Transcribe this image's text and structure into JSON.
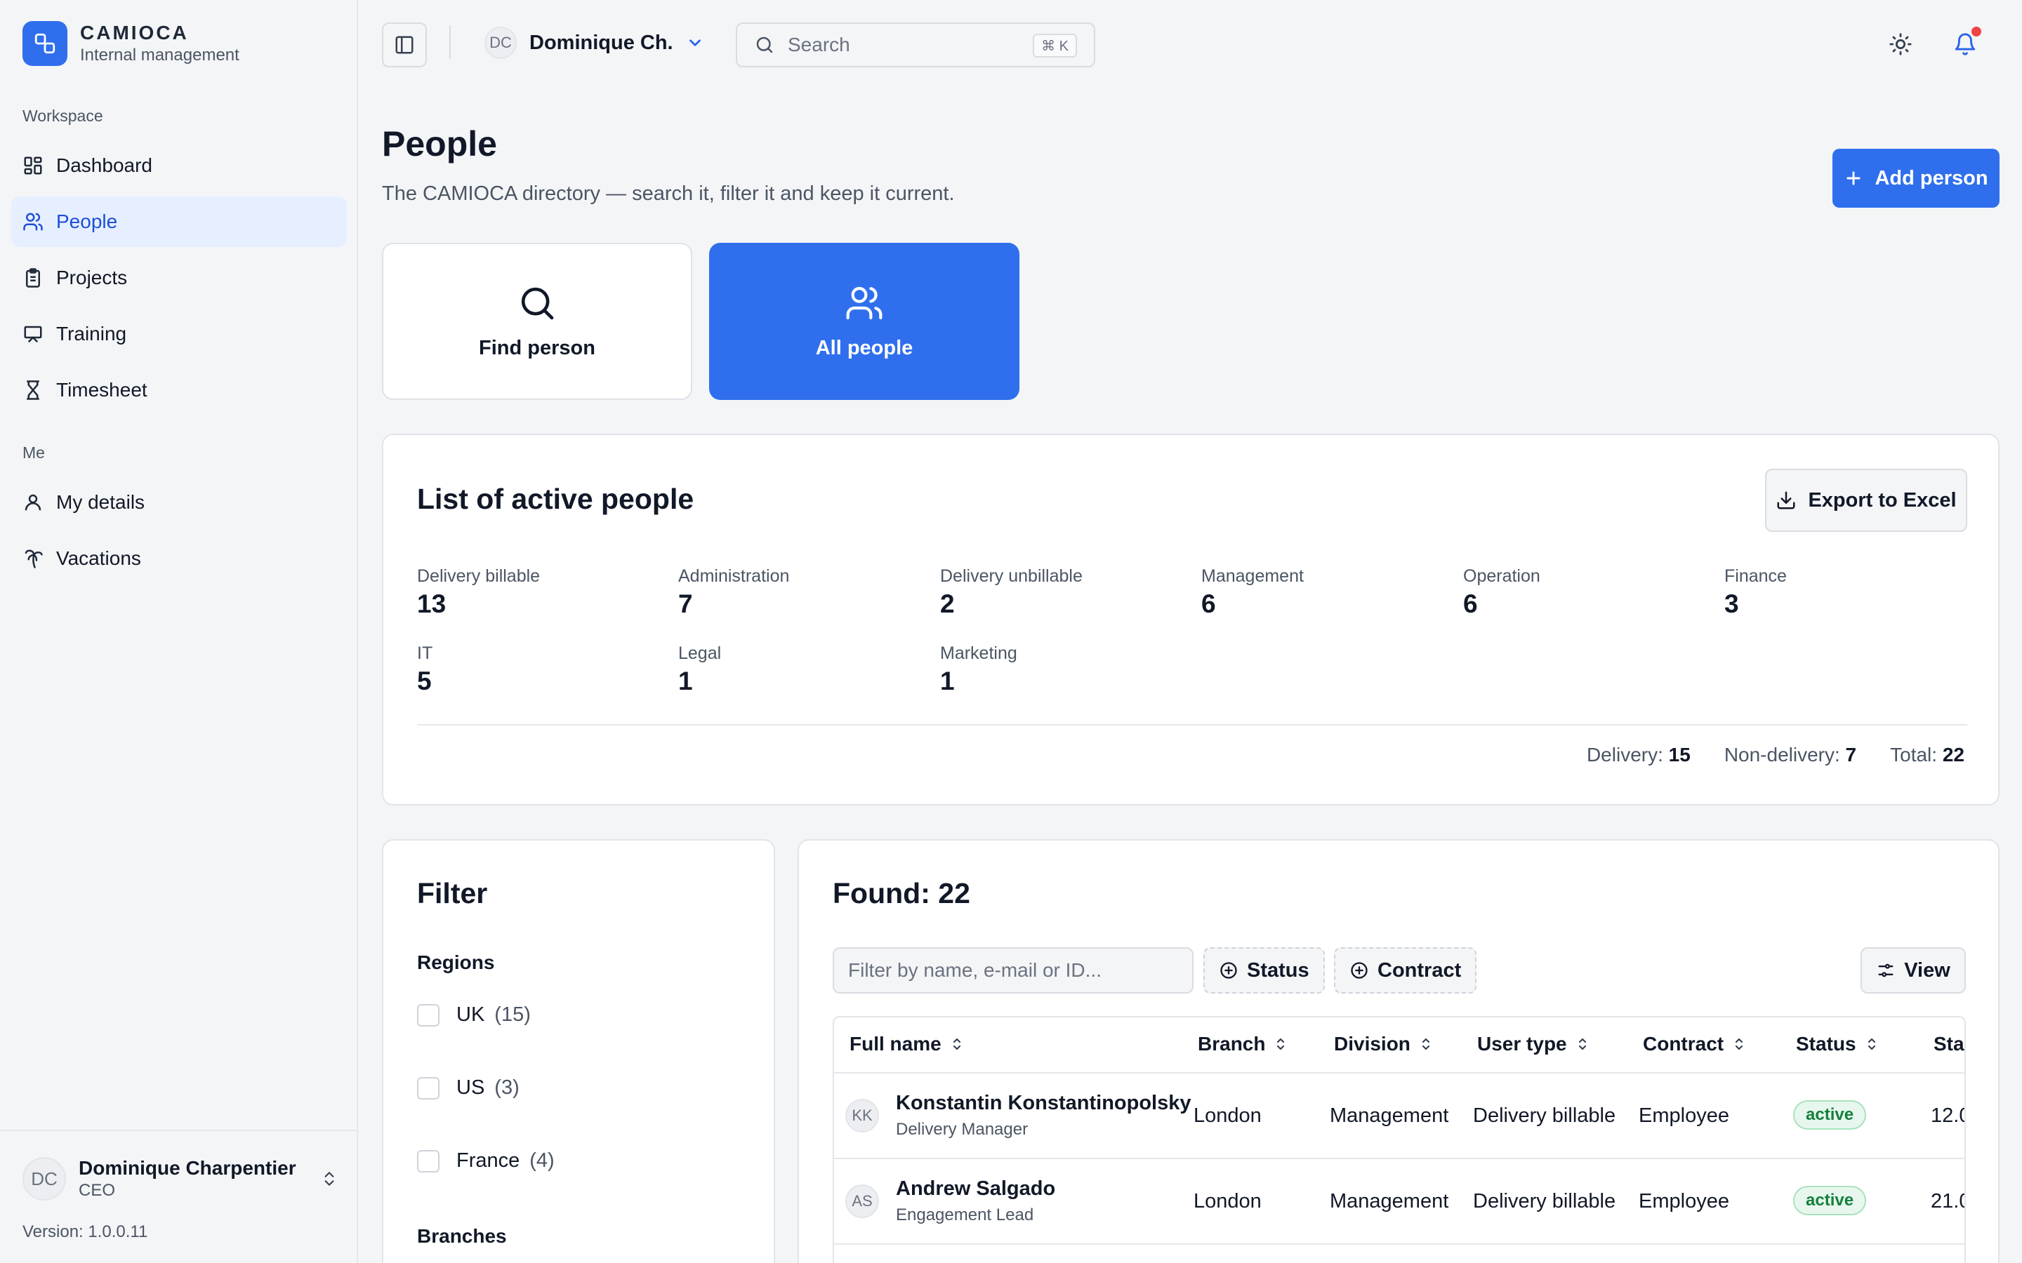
{
  "brand": {
    "name": "CAMIOCA",
    "subtitle": "Internal management"
  },
  "sidebar": {
    "workspace_label": "Workspace",
    "workspace_items": [
      {
        "label": "Dashboard",
        "icon": "dashboard-icon"
      },
      {
        "label": "People",
        "icon": "users-icon",
        "active": true
      },
      {
        "label": "Projects",
        "icon": "clipboard-icon"
      },
      {
        "label": "Training",
        "icon": "presentation-icon"
      },
      {
        "label": "Timesheet",
        "icon": "hourglass-icon"
      }
    ],
    "me_label": "Me",
    "me_items": [
      {
        "label": "My details",
        "icon": "user-icon"
      },
      {
        "label": "Vacations",
        "icon": "palm-tree-icon"
      }
    ],
    "user": {
      "initials": "DC",
      "name": "Dominique Charpentier",
      "role": "CEO"
    },
    "version": "Version: 1.0.0.11"
  },
  "topbar": {
    "user_initials": "DC",
    "user_short_name": "Dominique Ch.",
    "search_placeholder": "Search",
    "search_shortcut": "⌘ K"
  },
  "page": {
    "title": "People",
    "subtitle": "The CAMIOCA directory — search it, filter it and keep it current.",
    "add_button": "Add person"
  },
  "tiles": {
    "find": "Find person",
    "all": "All people"
  },
  "stats": {
    "title": "List of active people",
    "export_button": "Export to Excel",
    "items": [
      {
        "label": "Delivery billable",
        "value": "13"
      },
      {
        "label": "Administration",
        "value": "7"
      },
      {
        "label": "Delivery unbillable",
        "value": "2"
      },
      {
        "label": "Management",
        "value": "6"
      },
      {
        "label": "Operation",
        "value": "6"
      },
      {
        "label": "Finance",
        "value": "3"
      },
      {
        "label": "IT",
        "value": "5"
      },
      {
        "label": "Legal",
        "value": "1"
      },
      {
        "label": "Marketing",
        "value": "1"
      }
    ],
    "totals": {
      "delivery_label": "Delivery:",
      "delivery_value": "15",
      "non_delivery_label": "Non-delivery:",
      "non_delivery_value": "7",
      "total_label": "Total:",
      "total_value": "22"
    }
  },
  "filter": {
    "title": "Filter",
    "regions_label": "Regions",
    "regions": [
      {
        "name": "UK",
        "count": "(15)"
      },
      {
        "name": "US",
        "count": "(3)"
      },
      {
        "name": "France",
        "count": "(4)"
      }
    ],
    "branches_label": "Branches"
  },
  "results": {
    "title": "Found: 22",
    "filter_placeholder": "Filter by name, e-mail or ID...",
    "status_chip": "Status",
    "contract_chip": "Contract",
    "view_button": "View",
    "columns": [
      "Full name",
      "Branch",
      "Division",
      "User type",
      "Contract",
      "Status",
      "Sta"
    ],
    "rows": [
      {
        "initials": "KK",
        "name": "Konstantin Konstantinopolsky",
        "role": "Delivery Manager",
        "branch": "London",
        "division": "Management",
        "user_type": "Delivery billable",
        "contract": "Employee",
        "status": "active",
        "start": "12.0"
      },
      {
        "initials": "AS",
        "name": "Andrew Salgado",
        "role": "Engagement Lead",
        "branch": "London",
        "division": "Management",
        "user_type": "Delivery billable",
        "contract": "Employee",
        "status": "active",
        "start": "21.0"
      }
    ]
  },
  "colors": {
    "accent": "#2f6fed",
    "active_badge": "#15803d",
    "notification_dot": "#ef4444"
  }
}
